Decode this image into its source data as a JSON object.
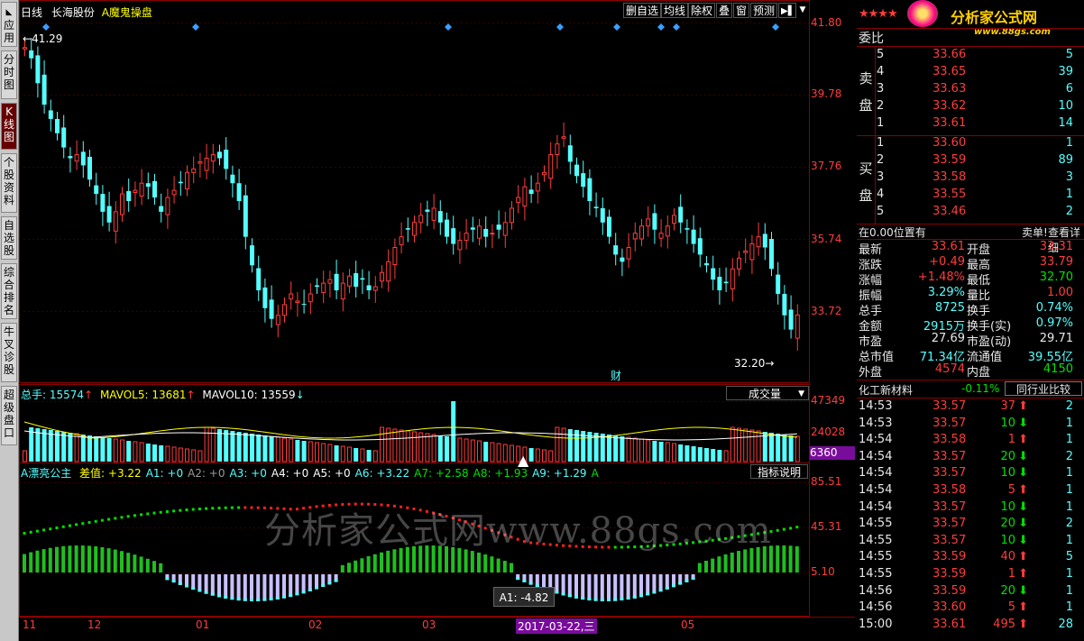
{
  "left_tabs": [
    "应用",
    "分时图",
    "K线图",
    "个股资料",
    "自选股",
    "综合排名",
    "牛叉诊股",
    "超级盘口"
  ],
  "header": {
    "period": "日线",
    "stock_name": "长海股份",
    "formula": "A魔鬼操盘",
    "toolbar": [
      "删自选",
      "均线",
      "除权",
      "叠",
      "窗",
      "预测"
    ],
    "nav_icon": "play-step-icon",
    "dropdown_icon": "caret-down-icon"
  },
  "price_axis": [
    "41.80",
    "39.78",
    "37.76",
    "35.74",
    "33.72"
  ],
  "annotations": {
    "high_label": "41.29",
    "low_label": "32.20",
    "finance_marker": "财"
  },
  "volume": {
    "label_total": "总手: 15574",
    "label_mavol5": "MAVOL5: 13681",
    "label_mavol10": "MAVOL10: 13559",
    "arrow_up": "↑",
    "arrow_down": "↓",
    "selector": "成交量",
    "axis": [
      "47349",
      "24028"
    ],
    "current": "6360"
  },
  "indicator": {
    "title": "A漂亮公主",
    "items": [
      {
        "text": "差值: +3.22",
        "color": "#ffff00"
      },
      {
        "text": "A1: +0",
        "color": "#54ffff"
      },
      {
        "text": "A2: +0",
        "color": "#999999"
      },
      {
        "text": "A3: +0",
        "color": "#54ffff"
      },
      {
        "text": "A4: +0",
        "color": "#ffffff"
      },
      {
        "text": "A5: +0",
        "color": "#ffffff"
      },
      {
        "text": "A6: +3.22",
        "color": "#54ffff"
      },
      {
        "text": "A7: +2.58",
        "color": "#00e000"
      },
      {
        "text": "A8: +1.93",
        "color": "#00e000"
      },
      {
        "text": "A9: +1.29",
        "color": "#54ffff"
      },
      {
        "text": "A",
        "color": "#00e000"
      }
    ],
    "help_button": "指标说明",
    "axis": [
      "85.51",
      "45.31",
      "5.10"
    ],
    "tooltip": "A1: -4.82"
  },
  "watermark": "分析家公式网www.88gs.com",
  "date_axis": [
    "11",
    "12",
    "01",
    "02",
    "03",
    "2017-03-22,三",
    "05"
  ],
  "right_panel": {
    "logo_text": "分析家公式网",
    "logo_url": "www.88gs.com",
    "weibi_label": "委比",
    "sell_label": "卖盘",
    "buy_label": "买盘",
    "sell_rows": [
      {
        "lvl": "5",
        "price": "33.66",
        "vol": "5"
      },
      {
        "lvl": "4",
        "price": "33.65",
        "vol": "39"
      },
      {
        "lvl": "3",
        "price": "33.63",
        "vol": "6"
      },
      {
        "lvl": "2",
        "price": "33.62",
        "vol": "10"
      },
      {
        "lvl": "1",
        "price": "33.61",
        "vol": "14"
      }
    ],
    "buy_rows": [
      {
        "lvl": "1",
        "price": "33.60",
        "vol": "1"
      },
      {
        "lvl": "2",
        "price": "33.59",
        "vol": "89"
      },
      {
        "lvl": "3",
        "price": "33.58",
        "vol": "3"
      },
      {
        "lvl": "4",
        "price": "33.55",
        "vol": "1"
      },
      {
        "lvl": "5",
        "price": "33.46",
        "vol": "2"
      }
    ],
    "position_text": "在0.00位置有",
    "sell_single": "卖单",
    "view_detail": "查看详细",
    "quote": [
      {
        "l1": "最新",
        "v1": "33.61",
        "c1": "#ff3c3c",
        "l2": "开盘",
        "v2": "33.31",
        "c2": "#ff3c3c"
      },
      {
        "l1": "涨跌",
        "v1": "+0.49",
        "c1": "#ff3c3c",
        "l2": "最高",
        "v2": "33.79",
        "c2": "#ff3c3c"
      },
      {
        "l1": "涨幅",
        "v1": "+1.48%",
        "c1": "#ff3c3c",
        "l2": "最低",
        "v2": "32.70",
        "c2": "#00e000"
      },
      {
        "l1": "振幅",
        "v1": "3.29%",
        "c1": "#54ffff",
        "l2": "量比",
        "v2": "1.00",
        "c2": "#ff3c3c"
      },
      {
        "l1": "总手",
        "v1": "8725",
        "c1": "#54ffff",
        "l2": "换手",
        "v2": "0.74%",
        "c2": "#54ffff"
      },
      {
        "l1": "金额",
        "v1": "2915万",
        "c1": "#54ffff",
        "l2": "换手(实)",
        "v2": "0.97%",
        "c2": "#54ffff"
      },
      {
        "l1": "市盈",
        "v1": "27.69",
        "c1": "#e8e8e8",
        "l2": "市盈(动)",
        "v2": "29.71",
        "c2": "#e8e8e8"
      },
      {
        "l1": "总市值",
        "v1": "71.34亿",
        "c1": "#54ffff",
        "l2": "流通值",
        "v2": "39.55亿",
        "c2": "#54ffff"
      },
      {
        "l1": "外盘",
        "v1": "4574",
        "c1": "#ff3c3c",
        "l2": "内盘",
        "v2": "4150",
        "c2": "#00e000"
      }
    ],
    "industry_name": "化工新材料",
    "industry_change": "-0.11%",
    "industry_compare": "同行业比较",
    "ticks": [
      {
        "t": "14:53",
        "p": "33.57",
        "v": "37",
        "dir": "up",
        "n": "2"
      },
      {
        "t": "14:53",
        "p": "33.57",
        "v": "10",
        "dir": "down",
        "n": "1"
      },
      {
        "t": "14:54",
        "p": "33.58",
        "v": "1",
        "dir": "up",
        "n": "1"
      },
      {
        "t": "14:54",
        "p": "33.57",
        "v": "20",
        "dir": "down",
        "n": "2"
      },
      {
        "t": "14:54",
        "p": "33.57",
        "v": "10",
        "dir": "down",
        "n": "1"
      },
      {
        "t": "14:54",
        "p": "33.58",
        "v": "5",
        "dir": "up",
        "n": "1"
      },
      {
        "t": "14:54",
        "p": "33.57",
        "v": "10",
        "dir": "down",
        "n": "1"
      },
      {
        "t": "14:55",
        "p": "33.57",
        "v": "20",
        "dir": "down",
        "n": "2"
      },
      {
        "t": "14:55",
        "p": "33.57",
        "v": "10",
        "dir": "down",
        "n": "1"
      },
      {
        "t": "14:55",
        "p": "33.59",
        "v": "40",
        "dir": "up",
        "n": "5"
      },
      {
        "t": "14:55",
        "p": "33.59",
        "v": "1",
        "dir": "up",
        "n": "1"
      },
      {
        "t": "14:56",
        "p": "33.59",
        "v": "20",
        "dir": "down",
        "n": "1"
      },
      {
        "t": "14:56",
        "p": "33.60",
        "v": "5",
        "dir": "up",
        "n": "1"
      },
      {
        "t": "15:00",
        "p": "33.61",
        "v": "495",
        "dir": "up",
        "n": "28"
      }
    ]
  }
}
